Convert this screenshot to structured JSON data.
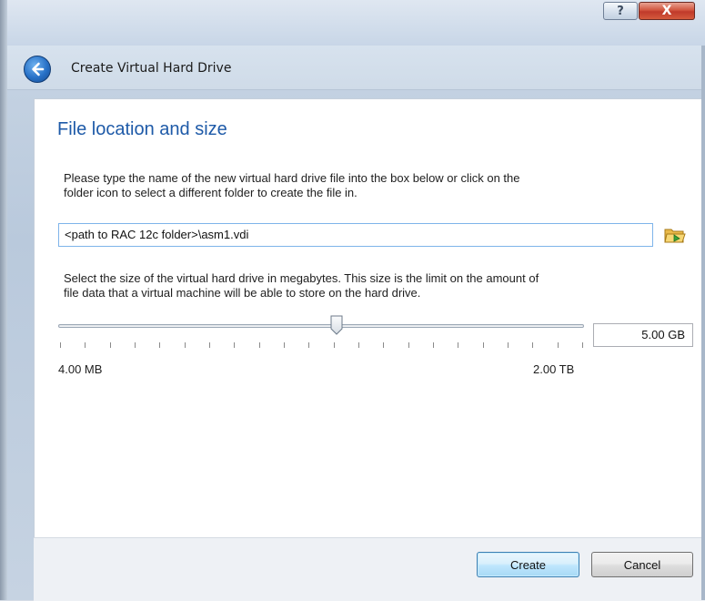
{
  "window": {
    "help_glyph": "?",
    "close_glyph": "X"
  },
  "header": {
    "title": "Create Virtual Hard Drive"
  },
  "page": {
    "heading": "File location and size",
    "location_desc_line1": "Please type the name of the new virtual hard drive file into the box below or click on the",
    "location_desc_line2": "folder icon to select a different folder to create the file in.",
    "path_value": "<path to RAC 12c folder>\\asm1.vdi",
    "size_desc_line1": "Select the size of the virtual hard drive in megabytes. This size is the limit on the amount of",
    "size_desc_line2": "file data that a virtual machine will be able to store on the hard drive.",
    "slider": {
      "min_label": "4.00 MB",
      "max_label": "2.00 TB",
      "position_fraction": 0.53
    },
    "size_value": "5.00 GB"
  },
  "footer": {
    "create_label": "Create",
    "cancel_label": "Cancel"
  },
  "icons": {
    "back": "back-arrow-icon",
    "folder": "folder-open-icon"
  },
  "colors": {
    "heading": "#1e5aa8",
    "close_button": "#c0392b",
    "input_focus_border": "#7eb4ea"
  }
}
